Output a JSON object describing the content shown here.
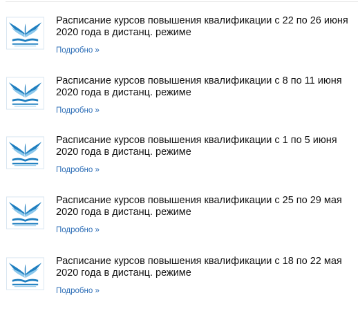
{
  "news": {
    "items": [
      {
        "title": "Расписание курсов повышения квалификации с 22 по 26 июня 2020 года в дистанц. режиме",
        "link_label": "Подробно »",
        "logo_icon": "institute-wings-book-logo-icon"
      },
      {
        "title": "Расписание курсов повышения квалификации с 8 по 11 июня 2020 года в дистанц. режиме",
        "link_label": "Подробно »",
        "logo_icon": "institute-wings-book-logo-icon"
      },
      {
        "title": "Расписание курсов повышения квалификации с 1 по 5 июня 2020 года в дистанц. режиме",
        "link_label": "Подробно »",
        "logo_icon": "institute-wings-book-logo-icon"
      },
      {
        "title": "Расписание курсов повышения квалификации с 25 по 29 мая 2020 года в дистанц. режиме",
        "link_label": "Подробно »",
        "logo_icon": "institute-wings-book-logo-icon"
      },
      {
        "title": "Расписание курсов повышения квалификации с 18 по 22 мая 2020 года в дистанц. режиме",
        "link_label": "Подробно »",
        "logo_icon": "institute-wings-book-logo-icon"
      }
    ]
  },
  "colors": {
    "link": "#2f6fb7",
    "logo_blue": "#1f7fc0",
    "logo_light": "#8cc8ec",
    "title_text": "#111111"
  }
}
